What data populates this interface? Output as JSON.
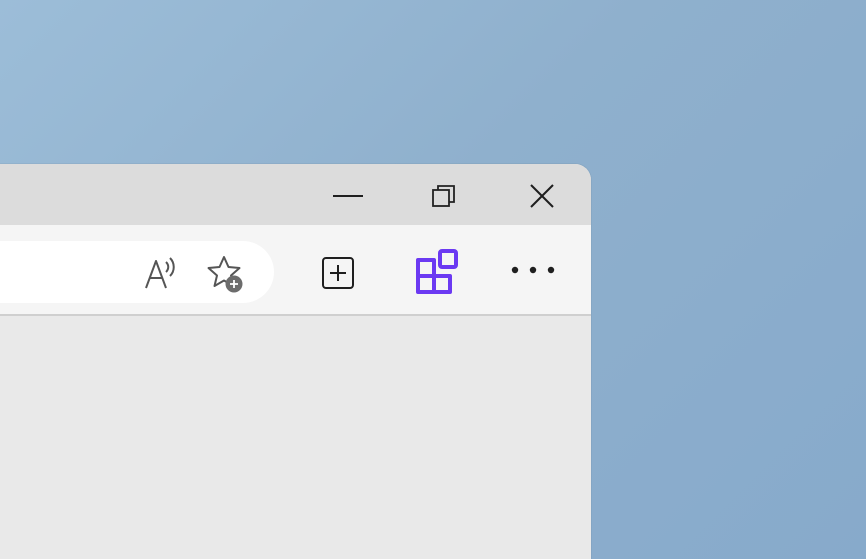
{
  "window": {
    "caption_buttons": [
      {
        "name": "minimize",
        "icon": "minimize-icon"
      },
      {
        "name": "restore",
        "icon": "restore-icon"
      },
      {
        "name": "close",
        "icon": "close-icon"
      }
    ]
  },
  "toolbar": {
    "icons": [
      {
        "name": "read-aloud",
        "icon": "read-aloud-icon"
      },
      {
        "name": "add-to-favorites",
        "icon": "star-plus-icon"
      },
      {
        "name": "collections",
        "icon": "collections-icon"
      },
      {
        "name": "extensions",
        "icon": "extensions-icon",
        "color": "#6b39f2"
      },
      {
        "name": "settings-and-more",
        "icon": "more-icon"
      }
    ]
  },
  "colors": {
    "desktop_background": "#93b5d2",
    "title_bar": "#dcdcdc",
    "toolbar": "#f5f5f5",
    "content": "#e9e9e9",
    "accent": "#6b39f2"
  }
}
